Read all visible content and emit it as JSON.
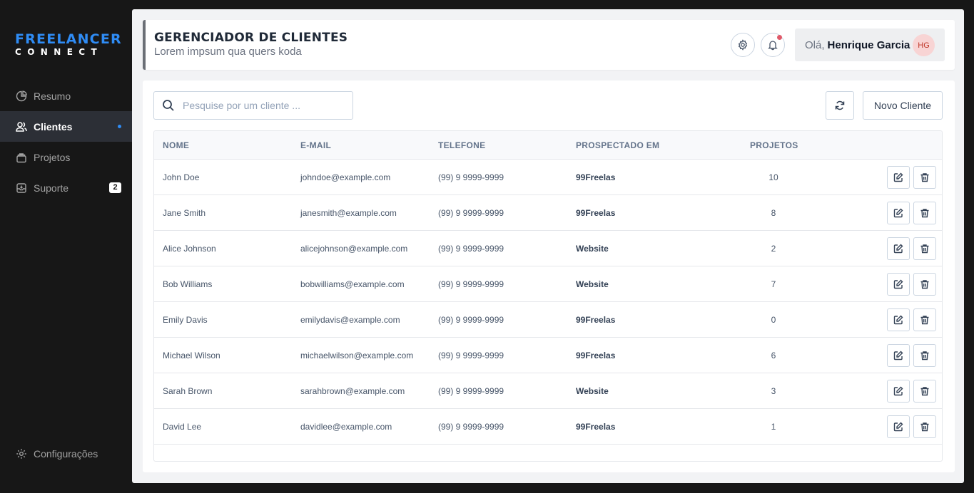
{
  "brand": {
    "line1": "FREELANCER",
    "line2": "CONNECT"
  },
  "sidebar": {
    "items": [
      {
        "label": "Resumo",
        "icon": "pie-chart-icon"
      },
      {
        "label": "Clientes",
        "icon": "users-icon",
        "active": true
      },
      {
        "label": "Projetos",
        "icon": "folder-icon"
      },
      {
        "label": "Suporte",
        "icon": "inbox-icon",
        "badge": "2"
      }
    ],
    "settings_label": "Configurações"
  },
  "header": {
    "title": "GERENCIADOR DE CLIENTES",
    "subtitle": "Lorem impsum qua quers koda",
    "greeting": "Olá,",
    "user_name": "Henrique Garcia",
    "avatar_initials": "HG"
  },
  "toolbar": {
    "search_placeholder": "Pesquise por um cliente ...",
    "new_client_label": "Novo Cliente"
  },
  "table": {
    "columns": [
      "NOME",
      "E-MAIL",
      "TELEFONE",
      "PROSPECTADO EM",
      "PROJETOS"
    ],
    "rows": [
      [
        "John Doe",
        "johndoe@example.com",
        "(99) 9 9999-9999",
        "99Freelas",
        "10"
      ],
      [
        "Jane Smith",
        "janesmith@example.com",
        "(99) 9 9999-9999",
        "99Freelas",
        "8"
      ],
      [
        "Alice Johnson",
        "alicejohnson@example.com",
        "(99) 9 9999-9999",
        "Website",
        "2"
      ],
      [
        "Bob Williams",
        "bobwilliams@example.com",
        "(99) 9 9999-9999",
        "Website",
        "7"
      ],
      [
        "Emily Davis",
        "emilydavis@example.com",
        "(99) 9 9999-9999",
        "99Freelas",
        "0"
      ],
      [
        "Michael Wilson",
        "michaelwilson@example.com",
        "(99) 9 9999-9999",
        "99Freelas",
        "6"
      ],
      [
        "Sarah Brown",
        "sarahbrown@example.com",
        "(99) 9 9999-9999",
        "Website",
        "3"
      ],
      [
        "David Lee",
        "davidlee@example.com",
        "(99) 9 9999-9999",
        "99Freelas",
        "1"
      ]
    ]
  },
  "colors": {
    "brand_blue": "#2f8cf5",
    "sidebar_bg": "#171717",
    "active_item_bg": "#2c2f36",
    "notification_dot": "#e05a6a",
    "avatar_bg": "#f8d4d4"
  }
}
